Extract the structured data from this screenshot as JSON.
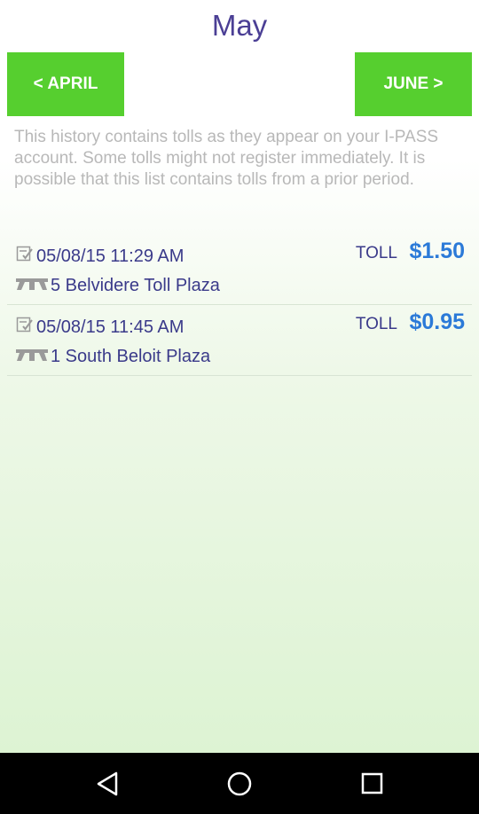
{
  "header": {
    "title": "May"
  },
  "nav": {
    "prev_label": "< APRIL",
    "next_label": "JUNE >"
  },
  "notice": "This history contains tolls as they appear on your I-PASS account. Some tolls might not register immediately. It is possible that this list contains tolls from a prior period.",
  "tolls": [
    {
      "datetime": "05/08/15 11:29 AM",
      "plaza": "5 Belvidere Toll Plaza",
      "type": "TOLL",
      "amount": "$1.50"
    },
    {
      "datetime": "05/08/15 11:45 AM",
      "plaza": "1 South Beloit Plaza",
      "type": "TOLL",
      "amount": "$0.95"
    }
  ],
  "system_nav": {
    "icons": [
      "back-icon",
      "home-icon",
      "recents-icon"
    ]
  },
  "colors": {
    "accent_green": "#56cf2f",
    "title_purple": "#4b3f95",
    "amount_blue": "#2b7ad8"
  }
}
